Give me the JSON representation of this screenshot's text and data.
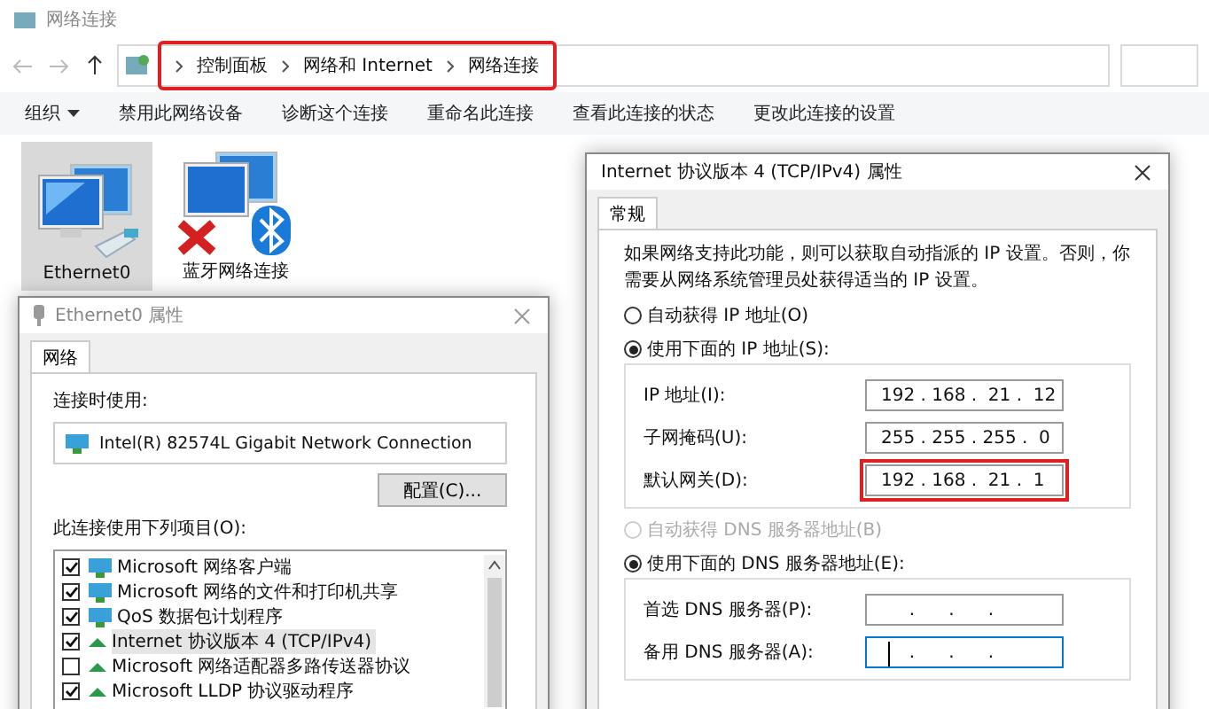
{
  "explorer": {
    "title": "网络连接",
    "breadcrumb": [
      {
        "label": "控制面板"
      },
      {
        "label": "网络和 Internet"
      },
      {
        "label": "网络连接"
      }
    ],
    "breadcrumb_highlighted": true,
    "toolbar": [
      {
        "label": "组织",
        "dropdown": true
      },
      {
        "label": "禁用此网络设备",
        "dropdown": false
      },
      {
        "label": "诊断这个连接",
        "dropdown": false
      },
      {
        "label": "重命名此连接",
        "dropdown": false
      },
      {
        "label": "查看此连接的状态",
        "dropdown": false
      },
      {
        "label": "更改此连接的设置",
        "dropdown": false
      }
    ],
    "connections": [
      {
        "name": "Ethernet0",
        "kind": "ethernet",
        "selected": true
      },
      {
        "name": "蓝牙网络连接",
        "kind": "bluetooth",
        "selected": false
      }
    ]
  },
  "adapter_dialog": {
    "title": "Ethernet0 属性",
    "tabs": [
      {
        "label": "网络",
        "selected": true
      }
    ],
    "connect_using_label": "连接时使用:",
    "adapter": "Intel(R) 82574L Gigabit Network Connection",
    "configure_button": "配置(C)...",
    "items_label": "此连接使用下列项目(O):",
    "items": [
      {
        "label": "Microsoft 网络客户端",
        "kind": "client",
        "checked": true,
        "selected": false
      },
      {
        "label": "Microsoft 网络的文件和打印机共享",
        "kind": "client",
        "checked": true,
        "selected": false
      },
      {
        "label": "QoS 数据包计划程序",
        "kind": "client",
        "checked": true,
        "selected": false
      },
      {
        "label": "Internet 协议版本 4 (TCP/IPv4)",
        "kind": "protocol",
        "checked": true,
        "selected": true
      },
      {
        "label": "Microsoft 网络适配器多路传送器协议",
        "kind": "protocol",
        "checked": false,
        "selected": false
      },
      {
        "label": "Microsoft LLDP 协议驱动程序",
        "kind": "protocol",
        "checked": true,
        "selected": false
      }
    ]
  },
  "ipv4_dialog": {
    "title": "Internet 协议版本 4 (TCP/IPv4) 属性",
    "tabs": [
      {
        "label": "常规",
        "selected": true
      }
    ],
    "description": "如果网络支持此功能，则可以获取自动指派的 IP 设置。否则，你需要从网络系统管理员处获得适当的 IP 设置。",
    "ip_options": [
      {
        "label": "自动获得 IP 地址(O)",
        "selected": false,
        "disabled": false
      },
      {
        "label": "使用下面的 IP 地址(S):",
        "selected": true,
        "disabled": false
      }
    ],
    "ip_fields": [
      {
        "label": "IP 地址(I):",
        "value": "192 . 168 .  21 .  12",
        "highlighted": false
      },
      {
        "label": "子网掩码(U):",
        "value": "255 . 255 . 255 .  0",
        "highlighted": false
      },
      {
        "label": "默认网关(D):",
        "value": "192 . 168 .  21 .  1",
        "highlighted": true
      }
    ],
    "dns_options": [
      {
        "label": "自动获得 DNS 服务器地址(B)",
        "selected": false,
        "disabled": true
      },
      {
        "label": "使用下面的 DNS 服务器地址(E):",
        "selected": true,
        "disabled": false
      }
    ],
    "dns_fields": [
      {
        "label": "首选 DNS 服务器(P):",
        "value": "     .      .      .",
        "focused": false
      },
      {
        "label": "备用 DNS 服务器(A):",
        "value": "     .      .      .",
        "focused": true
      }
    ]
  }
}
